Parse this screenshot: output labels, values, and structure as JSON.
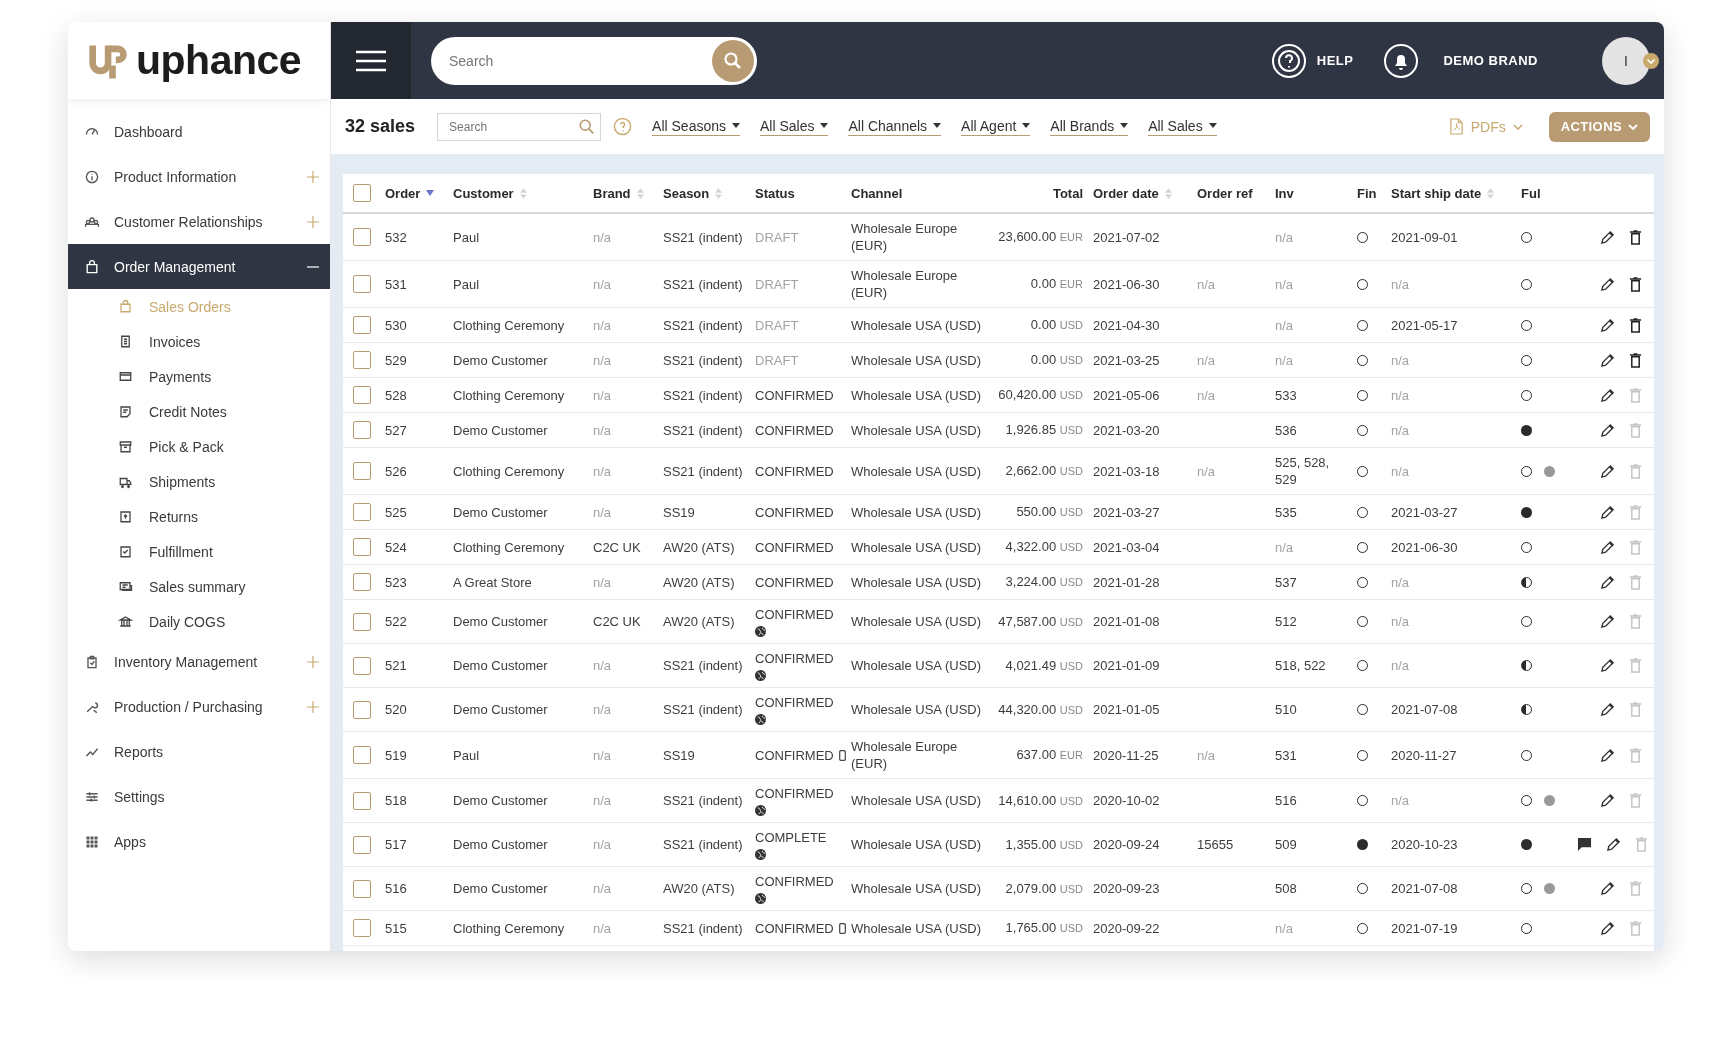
{
  "header": {
    "logo": "uphance",
    "search": {
      "placeholder": "Search"
    },
    "help": "HELP",
    "brand": "DEMO BRAND",
    "avatar": "I"
  },
  "sidebar": {
    "items": [
      {
        "label": "Dashboard",
        "selected": false
      },
      {
        "label": "Product Information",
        "selected": false,
        "expanded": false
      },
      {
        "label": "Customer Relationships",
        "selected": false,
        "expanded": false
      },
      {
        "label": "Order Management",
        "selected": true,
        "expanded": true,
        "children": [
          {
            "label": "Sales Orders",
            "selected": true
          },
          {
            "label": "Invoices",
            "selected": false
          },
          {
            "label": "Payments",
            "selected": false
          },
          {
            "label": "Credit Notes",
            "selected": false
          },
          {
            "label": "Pick & Pack",
            "selected": false
          },
          {
            "label": "Shipments",
            "selected": false
          },
          {
            "label": "Returns",
            "selected": false
          },
          {
            "label": "Fulfillment",
            "selected": false
          },
          {
            "label": "Sales summary",
            "selected": false
          },
          {
            "label": "Daily COGS",
            "selected": false
          }
        ]
      },
      {
        "label": "Inventory Management",
        "selected": false,
        "expanded": false
      },
      {
        "label": "Production / Purchasing",
        "selected": false,
        "expanded": false
      },
      {
        "label": "Reports",
        "selected": false
      },
      {
        "label": "Settings",
        "selected": false
      },
      {
        "label": "Apps",
        "selected": false
      }
    ]
  },
  "toolbar": {
    "count": "32 sales",
    "search": {
      "placeholder": "Search"
    },
    "filters": [
      "All Seasons",
      "All Sales",
      "All Channels",
      "All Agent",
      "All Brands",
      "All Sales"
    ],
    "pdfs": "PDFs",
    "actions": "ACTIONS"
  },
  "table": {
    "all_checked": false,
    "columns": [
      {
        "label": "Order",
        "sortable": true,
        "sorted": true
      },
      {
        "label": "Customer",
        "sortable": true,
        "sorted": false
      },
      {
        "label": "Brand",
        "sortable": true,
        "sorted": false
      },
      {
        "label": "Season",
        "sortable": true,
        "sorted": false
      },
      {
        "label": "Status",
        "sortable": false
      },
      {
        "label": "Channel",
        "sortable": false
      },
      {
        "label": "Total",
        "sortable": false
      },
      {
        "label": "Order date",
        "sortable": true,
        "sorted": false
      },
      {
        "label": "Order ref",
        "sortable": false
      },
      {
        "label": "Inv",
        "sortable": false
      },
      {
        "label": "Fin",
        "sortable": false
      },
      {
        "label": "Start ship date",
        "sortable": true,
        "sorted": false
      },
      {
        "label": "Ful",
        "sortable": false
      }
    ],
    "rows": [
      {
        "checked": false,
        "order": "532",
        "customer": "Paul",
        "brand": "n/a",
        "season": "SS21 (indent)",
        "status": "DRAFT",
        "channel": "Wholesale Europe (EUR)",
        "total": "23,600.00",
        "currency": "EUR",
        "order_date": "2021-07-02",
        "inv": "n/a",
        "fin_done": false,
        "ship": "2021-09-01",
        "ful_done": false,
        "ful_half": false,
        "ful_second": false,
        "comment": false,
        "deletable": true,
        "muted": {
          "brand": true,
          "status": true,
          "inv": true
        }
      },
      {
        "checked": false,
        "order": "531",
        "customer": "Paul",
        "brand": "n/a",
        "season": "SS21 (indent)",
        "status": "DRAFT",
        "channel": "Wholesale Europe (EUR)",
        "total": "0.00",
        "currency": "EUR",
        "order_date": "2021-06-30",
        "order_ref": "n/a",
        "inv": "n/a",
        "fin_done": false,
        "ship": "n/a",
        "ful_done": false,
        "ful_half": false,
        "ful_second": false,
        "comment": false,
        "deletable": true,
        "muted": {
          "brand": true,
          "status": true,
          "order_ref": true,
          "inv": true,
          "ship": true
        }
      },
      {
        "checked": false,
        "order": "530",
        "customer": "Clothing Ceremony",
        "brand": "n/a",
        "season": "SS21 (indent)",
        "status": "DRAFT",
        "channel": "Wholesale USA (USD)",
        "total": "0.00",
        "currency": "USD",
        "order_date": "2021-04-30",
        "inv": "n/a",
        "fin_done": false,
        "ship": "2021-05-17",
        "ful_done": false,
        "ful_half": false,
        "ful_second": false,
        "comment": false,
        "deletable": true,
        "muted": {
          "brand": true,
          "status": true,
          "inv": true
        }
      },
      {
        "checked": false,
        "order": "529",
        "customer": "Demo Customer",
        "brand": "n/a",
        "season": "SS21 (indent)",
        "status": "DRAFT",
        "channel": "Wholesale USA (USD)",
        "total": "0.00",
        "currency": "USD",
        "order_date": "2021-03-25",
        "order_ref": "n/a",
        "inv": "n/a",
        "fin_done": false,
        "ship": "n/a",
        "ful_done": false,
        "ful_half": false,
        "ful_second": false,
        "comment": false,
        "deletable": true,
        "muted": {
          "brand": true,
          "status": true,
          "order_ref": true,
          "inv": true,
          "ship": true
        }
      },
      {
        "checked": false,
        "order": "528",
        "customer": "Clothing Ceremony",
        "brand": "n/a",
        "season": "SS21 (indent)",
        "status": "CONFIRMED",
        "channel": "Wholesale USA (USD)",
        "total": "60,420.00",
        "currency": "USD",
        "order_date": "2021-05-06",
        "order_ref": "n/a",
        "inv": "533",
        "fin_done": false,
        "ship": "n/a",
        "ful_done": false,
        "ful_half": false,
        "ful_second": false,
        "comment": false,
        "deletable": false,
        "muted": {
          "brand": true,
          "order_ref": true,
          "ship": true
        }
      },
      {
        "checked": false,
        "order": "527",
        "customer": "Demo Customer",
        "brand": "n/a",
        "season": "SS21 (indent)",
        "status": "CONFIRMED",
        "channel": "Wholesale USA (USD)",
        "total": "1,926.85",
        "currency": "USD",
        "order_date": "2021-03-20",
        "inv": "536",
        "fin_done": false,
        "ship": "n/a",
        "ful_done": true,
        "ful_second": false,
        "comment": false,
        "deletable": false,
        "muted": {
          "brand": true,
          "ship": true
        }
      },
      {
        "checked": false,
        "order": "526",
        "customer": "Clothing Ceremony",
        "brand": "n/a",
        "season": "SS21 (indent)",
        "status": "CONFIRMED",
        "channel": "Wholesale USA (USD)",
        "total": "2,662.00",
        "currency": "USD",
        "order_date": "2021-03-18",
        "order_ref": "n/a",
        "inv": "525, 528, 529",
        "fin_done": false,
        "ship": "n/a",
        "ful_done": false,
        "ful_half": false,
        "ful_second": true,
        "comment": false,
        "deletable": false,
        "muted": {
          "brand": true,
          "order_ref": true,
          "ship": true
        }
      },
      {
        "checked": false,
        "order": "525",
        "customer": "Demo Customer",
        "brand": "n/a",
        "season": "SS19",
        "status": "CONFIRMED",
        "channel": "Wholesale USA (USD)",
        "total": "550.00",
        "currency": "USD",
        "order_date": "2021-03-27",
        "inv": "535",
        "fin_done": false,
        "ship": "2021-03-27",
        "ful_done": true,
        "ful_second": false,
        "comment": false,
        "deletable": false,
        "muted": {
          "brand": true
        }
      },
      {
        "checked": false,
        "order": "524",
        "customer": "Clothing Ceremony",
        "brand": "C2C UK",
        "season": "AW20 (ATS)",
        "status": "CONFIRMED",
        "channel": "Wholesale USA (USD)",
        "total": "4,322.00",
        "currency": "USD",
        "order_date": "2021-03-04",
        "inv": "n/a",
        "fin_done": false,
        "ship": "2021-06-30",
        "ful_done": false,
        "ful_half": false,
        "ful_second": false,
        "comment": false,
        "deletable": false,
        "muted": {
          "inv": true
        }
      },
      {
        "checked": false,
        "order": "523",
        "customer": "A Great Store",
        "brand": "n/a",
        "season": "AW20 (ATS)",
        "status": "CONFIRMED",
        "channel": "Wholesale USA (USD)",
        "total": "3,224.00",
        "currency": "USD",
        "order_date": "2021-01-28",
        "inv": "537",
        "fin_done": false,
        "ship": "n/a",
        "ful_done": false,
        "ful_half": true,
        "ful_second": false,
        "comment": false,
        "deletable": false,
        "muted": {
          "brand": true,
          "ship": true
        }
      },
      {
        "checked": false,
        "order": "522",
        "customer": "Demo Customer",
        "brand": "C2C UK",
        "season": "AW20 (ATS)",
        "status": "CONFIRMED",
        "globe_icon": true,
        "channel": "Wholesale USA (USD)",
        "total": "47,587.00",
        "currency": "USD",
        "order_date": "2021-01-08",
        "inv": "512",
        "fin_done": false,
        "ship": "n/a",
        "ful_done": false,
        "ful_half": false,
        "ful_second": false,
        "comment": false,
        "deletable": false,
        "muted": {
          "ship": true
        }
      },
      {
        "checked": false,
        "order": "521",
        "customer": "Demo Customer",
        "brand": "n/a",
        "season": "SS21 (indent)",
        "status": "CONFIRMED",
        "globe_icon": true,
        "channel": "Wholesale USA (USD)",
        "total": "4,021.49",
        "currency": "USD",
        "order_date": "2021-01-09",
        "inv": "518, 522",
        "fin_done": false,
        "ship": "n/a",
        "ful_done": false,
        "ful_half": true,
        "ful_second": false,
        "comment": false,
        "deletable": false,
        "muted": {
          "brand": true,
          "ship": true
        }
      },
      {
        "checked": false,
        "order": "520",
        "customer": "Demo Customer",
        "brand": "n/a",
        "season": "SS21 (indent)",
        "status": "CONFIRMED",
        "globe_icon": true,
        "channel": "Wholesale USA (USD)",
        "total": "44,320.00",
        "currency": "USD",
        "order_date": "2021-01-05",
        "inv": "510",
        "fin_done": false,
        "ship": "2021-07-08",
        "ful_done": false,
        "ful_half": true,
        "ful_second": false,
        "comment": false,
        "deletable": false,
        "muted": {
          "brand": true
        }
      },
      {
        "checked": false,
        "order": "519",
        "customer": "Paul",
        "brand": "n/a",
        "season": "SS19",
        "status": "CONFIRMED",
        "phone_icon": true,
        "channel": "Wholesale Europe (EUR)",
        "total": "637.00",
        "currency": "EUR",
        "order_date": "2020-11-25",
        "order_ref": "n/a",
        "inv": "531",
        "fin_done": false,
        "ship": "2020-11-27",
        "ful_done": false,
        "ful_half": false,
        "ful_second": false,
        "comment": false,
        "deletable": false,
        "muted": {
          "brand": true,
          "order_ref": true
        }
      },
      {
        "checked": false,
        "order": "518",
        "customer": "Demo Customer",
        "brand": "n/a",
        "season": "SS21 (indent)",
        "status": "CONFIRMED",
        "globe_icon": true,
        "channel": "Wholesale USA (USD)",
        "total": "14,610.00",
        "currency": "USD",
        "order_date": "2020-10-02",
        "inv": "516",
        "fin_done": false,
        "ship": "n/a",
        "ful_done": false,
        "ful_half": false,
        "ful_second": true,
        "comment": false,
        "deletable": false,
        "muted": {
          "brand": true,
          "ship": true
        }
      },
      {
        "checked": false,
        "order": "517",
        "customer": "Demo Customer",
        "brand": "n/a",
        "season": "SS21 (indent)",
        "status": "COMPLETE",
        "globe_icon": true,
        "channel": "Wholesale USA (USD)",
        "total": "1,355.00",
        "currency": "USD",
        "order_date": "2020-09-24",
        "order_ref": "15655",
        "inv": "509",
        "fin_done": true,
        "ship": "2020-10-23",
        "ful_done": true,
        "ful_second": false,
        "comment": true,
        "deletable": false,
        "muted": {
          "brand": true
        }
      },
      {
        "checked": false,
        "order": "516",
        "customer": "Demo Customer",
        "brand": "n/a",
        "season": "AW20 (ATS)",
        "status": "CONFIRMED",
        "globe_icon": true,
        "channel": "Wholesale USA (USD)",
        "total": "2,079.00",
        "currency": "USD",
        "order_date": "2020-09-23",
        "inv": "508",
        "fin_done": false,
        "ship": "2021-07-08",
        "ful_done": false,
        "ful_half": false,
        "ful_second": true,
        "comment": false,
        "deletable": false,
        "muted": {
          "brand": true
        }
      },
      {
        "checked": false,
        "order": "515",
        "customer": "Clothing Ceremony",
        "brand": "n/a",
        "season": "SS21 (indent)",
        "status": "CONFIRMED",
        "phone_icon": true,
        "channel": "Wholesale USA (USD)",
        "total": "1,765.00",
        "currency": "USD",
        "order_date": "2020-09-22",
        "inv": "n/a",
        "fin_done": false,
        "ship": "2021-07-19",
        "ful_done": false,
        "ful_half": false,
        "ful_second": false,
        "comment": false,
        "deletable": false,
        "muted": {
          "brand": true,
          "inv": true
        }
      }
    ]
  }
}
